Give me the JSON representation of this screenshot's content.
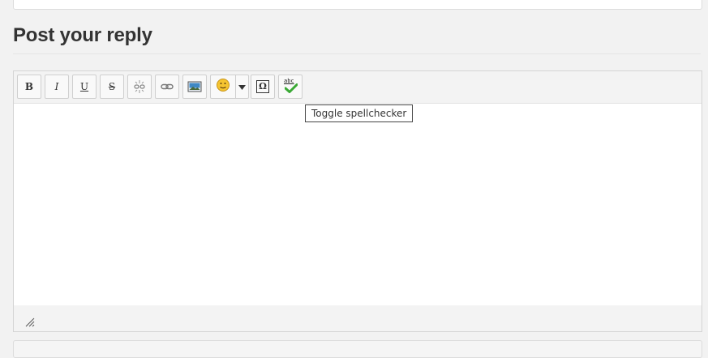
{
  "section": {
    "heading": "Post your reply"
  },
  "editor": {
    "toolbar": {
      "bold_label": "B",
      "italic_label": "I",
      "underline_label": "U",
      "strike_label": "S",
      "unlink_icon": "unlink-icon",
      "link_icon": "link-icon",
      "image_icon": "image-icon",
      "emoji_icon": "smiley-icon",
      "emoji_dropdown_icon": "caret-down-icon",
      "special_char_label": "Ω",
      "spellcheck_label": "abc",
      "spellcheck_icon": "spellcheck-icon"
    },
    "tooltip": "Toggle spellchecker",
    "status_bar": {
      "resize_icon": "resize-handle-icon"
    }
  },
  "colors": {
    "page_bg": "#f2f2f2",
    "toolbar_bg": "#f3f3f3",
    "check_green": "#3aa935"
  }
}
